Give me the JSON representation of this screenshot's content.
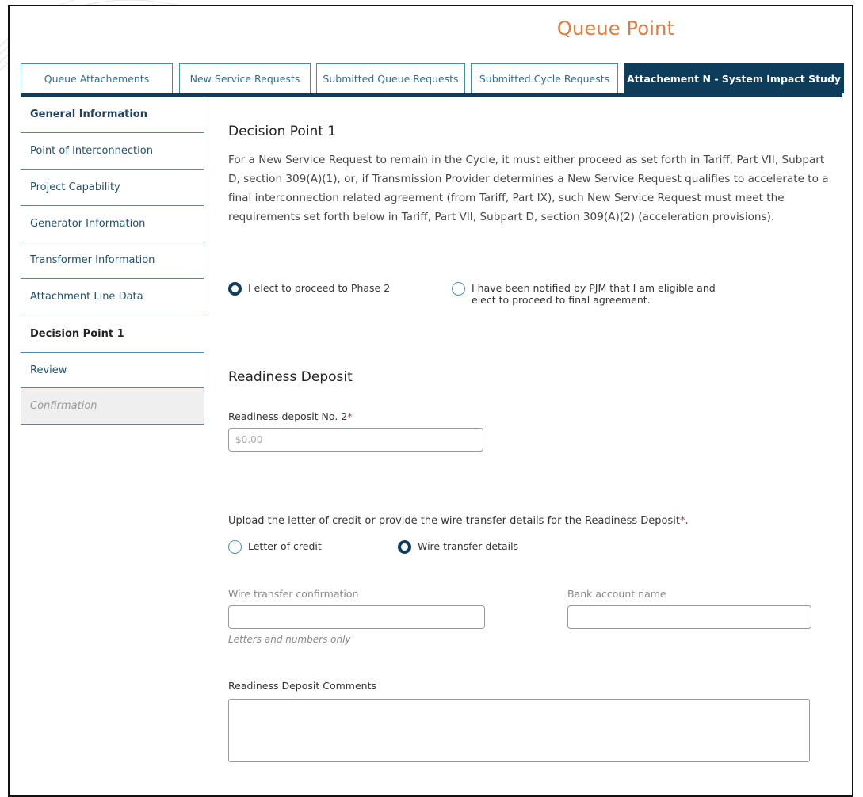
{
  "app": {
    "title": "Queue Point"
  },
  "tabs": [
    {
      "label": "Queue Attachements"
    },
    {
      "label": "New Service Requests"
    },
    {
      "label": "Submitted Queue Requests"
    },
    {
      "label": "Submitted Cycle Requests"
    },
    {
      "label": "Attachement N - System Impact Study"
    }
  ],
  "sidebar": {
    "items": [
      {
        "label": "General Information"
      },
      {
        "label": "Point of Interconnection"
      },
      {
        "label": "Project Capability"
      },
      {
        "label": "Generator Information"
      },
      {
        "label": "Transformer Information"
      },
      {
        "label": "Attachment Line Data"
      },
      {
        "label": "Decision Point 1"
      },
      {
        "label": "Review"
      },
      {
        "label": "Confirmation"
      }
    ]
  },
  "decision": {
    "heading": "Decision Point 1",
    "paragraph": "For a New Service Request to remain in the Cycle, it must either proceed as set forth in Tariff, Part VII, Subpart D, section 309(A)(1), or, if Transmission Provider determines a New Service Request qualifies to accelerate to a final interconnection related agreement (from Tariff, Part IX), such New Service Request must meet the requirements set forth below in Tariff, Part VII, Subpart D, section 309(A)(2) (acceleration provisions).",
    "option1": "I elect to proceed to Phase 2",
    "option2_line1": "I have been notified by PJM that I am eligible and",
    "option2_line2": "elect to proceed to final agreement."
  },
  "deposit": {
    "heading": "Readiness Deposit",
    "amount_label": "Readiness deposit No. 2",
    "required_mark": "*",
    "amount_placeholder": "$0.00",
    "upload_prompt": "Upload the letter of credit or provide the wire transfer details for the Readiness Deposit",
    "upload_required": "*",
    "upload_end": ".",
    "option_letter": "Letter of credit",
    "option_wire": "Wire transfer details",
    "wire_label": "Wire transfer confirmation",
    "wire_hint": "Letters and numbers only",
    "bank_label": "Bank account name",
    "comments_label": "Readiness Deposit Comments"
  }
}
